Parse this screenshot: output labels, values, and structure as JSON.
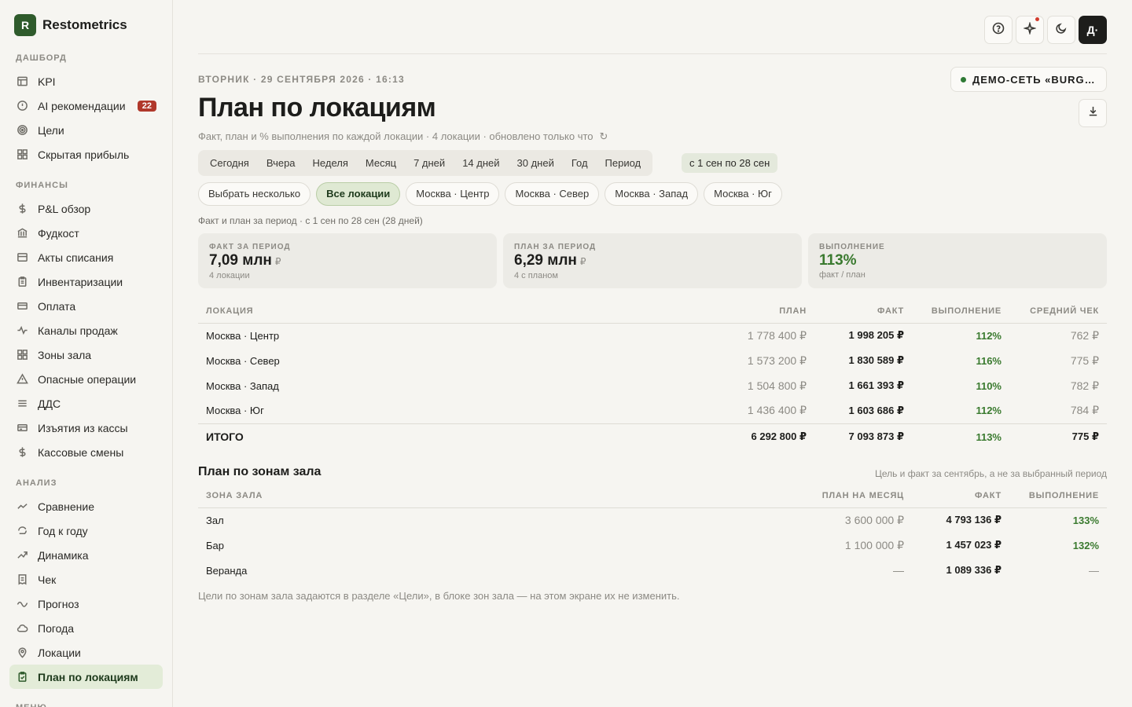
{
  "brand": {
    "logo_letter": "R",
    "name": "Restometrics"
  },
  "sidebar": {
    "sections": [
      {
        "title": "ДАШБОРД",
        "items": [
          {
            "label": "KPI",
            "icon": "table-icon"
          },
          {
            "label": "AI рекомендации",
            "icon": "alert-circle-icon",
            "badge": "22"
          },
          {
            "label": "Цели",
            "icon": "target-icon"
          },
          {
            "label": "Скрытая прибыль",
            "icon": "grid-icon"
          }
        ]
      },
      {
        "title": "ФИНАНСЫ",
        "items": [
          {
            "label": "P&L обзор",
            "icon": "dollar-icon"
          },
          {
            "label": "Фудкост",
            "icon": "bank-icon"
          },
          {
            "label": "Акты списания",
            "icon": "box-icon"
          },
          {
            "label": "Инвентаризации",
            "icon": "clipboard-icon"
          },
          {
            "label": "Оплата",
            "icon": "card-icon"
          },
          {
            "label": "Каналы продаж",
            "icon": "activity-icon"
          },
          {
            "label": "Зоны зала",
            "icon": "grid-icon"
          },
          {
            "label": "Опасные операции",
            "icon": "warning-icon"
          },
          {
            "label": "ДДС",
            "icon": "menu-icon"
          },
          {
            "label": "Изъятия из кассы",
            "icon": "register-icon"
          },
          {
            "label": "Кассовые смены",
            "icon": "dollar-icon"
          }
        ]
      },
      {
        "title": "АНАЛИЗ",
        "items": [
          {
            "label": "Сравнение",
            "icon": "chart-line-icon"
          },
          {
            "label": "Год к году",
            "icon": "loop-icon"
          },
          {
            "label": "Динамика",
            "icon": "trend-up-icon"
          },
          {
            "label": "Чек",
            "icon": "receipt-icon"
          },
          {
            "label": "Прогноз",
            "icon": "wave-icon"
          },
          {
            "label": "Погода",
            "icon": "cloud-icon"
          },
          {
            "label": "Локации",
            "icon": "pin-icon"
          },
          {
            "label": "План по локациям",
            "icon": "clipboard-check-icon",
            "active": true
          }
        ]
      },
      {
        "title": "МЕНЮ",
        "items": []
      }
    ]
  },
  "topbar": {
    "avatar": "Д·"
  },
  "header": {
    "dateline": "ВТОРНИК · 29 СЕНТЯБРЯ 2026 · 16:13",
    "org": "ДЕМО-СЕТЬ «BURGER",
    "title": "План по локациям",
    "subtitle": "Факт, план и % выполнения по каждой локации · 4 локации · обновлено только что",
    "refresh_glyph": "↻"
  },
  "periods": {
    "tabs": [
      "Сегодня",
      "Вчера",
      "Неделя",
      "Месяц",
      "7 дней",
      "14 дней",
      "30 дней",
      "Год",
      "Период"
    ],
    "range": "с 1 сен по 28 сен"
  },
  "locations": {
    "chips": [
      {
        "label": "Выбрать несколько",
        "active": false
      },
      {
        "label": "Все локации",
        "active": true
      },
      {
        "label": "Москва · Центр",
        "active": false
      },
      {
        "label": "Москва · Север",
        "active": false
      },
      {
        "label": "Москва · Запад",
        "active": false
      },
      {
        "label": "Москва · Юг",
        "active": false
      }
    ]
  },
  "period_note": "Факт и план за период · с 1 сен по 28 сен (28 дней)",
  "kpis": [
    {
      "label": "ФАКТ ЗА ПЕРИОД",
      "value": "7,09 млн",
      "unit": "₽",
      "sub": "4 локации"
    },
    {
      "label": "ПЛАН ЗА ПЕРИОД",
      "value": "6,29 млн",
      "unit": "₽",
      "sub": "4 с планом"
    },
    {
      "label": "ВЫПОЛНЕНИЕ",
      "value": "113%",
      "unit": "",
      "sub": "факт / план"
    }
  ],
  "loc_table": {
    "headers": [
      "ЛОКАЦИЯ",
      "ПЛАН",
      "ФАКТ",
      "ВЫПОЛНЕНИЕ",
      "СРЕДНИЙ ЧЕК"
    ],
    "rows": [
      [
        "Москва · Центр",
        "1 778 400 ₽",
        "1 998 205 ₽",
        "112%",
        "762 ₽"
      ],
      [
        "Москва · Север",
        "1 573 200 ₽",
        "1 830 589 ₽",
        "116%",
        "775 ₽"
      ],
      [
        "Москва · Запад",
        "1 504 800 ₽",
        "1 661 393 ₽",
        "110%",
        "782 ₽"
      ],
      [
        "Москва · Юг",
        "1 436 400 ₽",
        "1 603 686 ₽",
        "112%",
        "784 ₽"
      ]
    ],
    "total": [
      "ИТОГО",
      "6 292 800 ₽",
      "7 093 873 ₽",
      "113%",
      "775 ₽"
    ]
  },
  "zones": {
    "title": "План по зонам зала",
    "note": "Цель и факт за сентябрь, а не за выбранный период",
    "headers": [
      "ЗОНА ЗАЛА",
      "ПЛАН НА МЕСЯЦ",
      "ФАКТ",
      "ВЫПОЛНЕНИЕ"
    ],
    "rows": [
      [
        "Зал",
        "3 600 000 ₽",
        "4 793 136 ₽",
        "133%"
      ],
      [
        "Бар",
        "1 100 000 ₽",
        "1 457 023 ₽",
        "132%"
      ],
      [
        "Веранда",
        "—",
        "1 089 336 ₽",
        "—"
      ]
    ],
    "footer": "Цели по зонам зала задаются в разделе «Цели», в блоке зон зала — на этом экране их не изменить."
  }
}
